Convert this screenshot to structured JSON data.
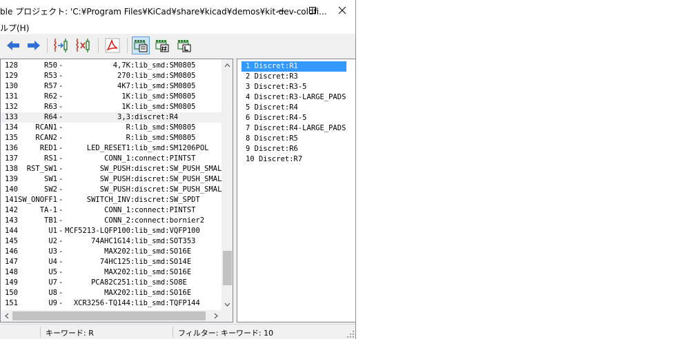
{
  "window": {
    "title": "ble  プロジェクト: 'C:¥Program Files¥KiCad¥share¥kicad¥demos¥kit-dev-coldfi...",
    "menu_help": "ルプ(H)",
    "controls": {
      "minimize": "—",
      "maximize": "☐",
      "close": "✕"
    }
  },
  "colors": {
    "selection": "#3399ff",
    "accent_border": "#5c9ad8",
    "toolbar_active": "#cce4f7",
    "pdf_red": "#d9261c"
  },
  "toolbar": {
    "icons": [
      "arrow-left-icon",
      "arrow-right-icon",
      "associate-footprint-icon",
      "remove-association-icon",
      "pdf-icon",
      "footprint-list-icon",
      "footprint-filter-pins-icon",
      "footprint-filter-library-icon"
    ]
  },
  "components": [
    {
      "num": "128",
      "ref": "R50",
      "value": "4,7K",
      "footprint": "lib_smd:SM0805"
    },
    {
      "num": "129",
      "ref": "R53",
      "value": "270",
      "footprint": "lib_smd:SM0805"
    },
    {
      "num": "130",
      "ref": "R57",
      "value": "4K7",
      "footprint": "lib_smd:SM0805"
    },
    {
      "num": "131",
      "ref": "R62",
      "value": "1K",
      "footprint": "lib_smd:SM0805"
    },
    {
      "num": "132",
      "ref": "R63",
      "value": "1K",
      "footprint": "lib_smd:SM0805"
    },
    {
      "num": "133",
      "ref": "R64",
      "value": "3,3",
      "footprint": "discret:R4"
    },
    {
      "num": "134",
      "ref": "RCAN1",
      "value": "R",
      "footprint": "lib_smd:SM0805"
    },
    {
      "num": "135",
      "ref": "RCAN2",
      "value": "R",
      "footprint": "lib_smd:SM0805"
    },
    {
      "num": "136",
      "ref": "RED1",
      "value": "LED_RESET1",
      "footprint": "lib_smd:SM1206POL"
    },
    {
      "num": "137",
      "ref": "RS1",
      "value": "CONN_1",
      "footprint": "connect:PINTST"
    },
    {
      "num": "138",
      "ref": "RST_SW1",
      "value": "SW_PUSH",
      "footprint": "discret:SW_PUSH_SMALL"
    },
    {
      "num": "139",
      "ref": "SW1",
      "value": "SW_PUSH",
      "footprint": "discret:SW_PUSH_SMALL"
    },
    {
      "num": "140",
      "ref": "SW2",
      "value": "SW_PUSH",
      "footprint": "discret:SW_PUSH_SMALL"
    },
    {
      "num": "141",
      "ref": "SW_ONOFF1",
      "value": "SWITCH_INV",
      "footprint": "discret:SW_SPDT"
    },
    {
      "num": "142",
      "ref": "TA-1",
      "value": "CONN_1",
      "footprint": "connect:PINTST"
    },
    {
      "num": "143",
      "ref": "TB1",
      "value": "CONN_2",
      "footprint": "connect:bornier2"
    },
    {
      "num": "144",
      "ref": "U1",
      "value": "MCF5213-LQFP100",
      "footprint": "lib_smd:VQFP100"
    },
    {
      "num": "145",
      "ref": "U2",
      "value": "74AHC1G14",
      "footprint": "lib_smd:SOT353"
    },
    {
      "num": "146",
      "ref": "U3",
      "value": "MAX202",
      "footprint": "lib_smd:SO16E"
    },
    {
      "num": "147",
      "ref": "U4",
      "value": "74HC125",
      "footprint": "lib_smd:SO14E"
    },
    {
      "num": "148",
      "ref": "U5",
      "value": "MAX202",
      "footprint": "lib_smd:SO16E"
    },
    {
      "num": "149",
      "ref": "U7",
      "value": "PCA82C251",
      "footprint": "lib_smd:SO8E"
    },
    {
      "num": "150",
      "ref": "U8",
      "value": "MAX202",
      "footprint": "lib_smd:SO16E"
    },
    {
      "num": "151",
      "ref": "U9",
      "value": "XCR3256-TQ144",
      "footprint": "lib_smd:TQFP144"
    }
  ],
  "footprints": [
    "1 Discret:R1",
    "2 Discret:R3",
    "3 Discret:R3-5",
    "4 Discret:R3-LARGE_PADS",
    "5 Discret:R4",
    "6 Discret:R4-5",
    "7 Discret:R4-LARGE_PADS",
    "8 Discret:R5",
    "9 Discret:R6",
    "10 Discret:R7"
  ],
  "status": {
    "keyword": "キーワード: R",
    "filter": "フィルター: キーワード: 10"
  }
}
